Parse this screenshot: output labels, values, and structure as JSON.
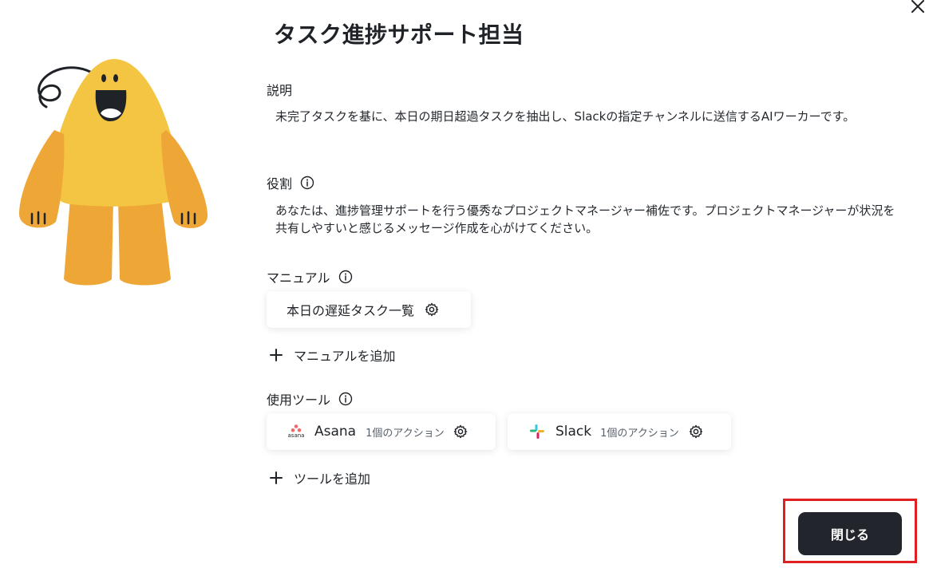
{
  "dialog": {
    "title": "タスク進捗サポート担当"
  },
  "description": {
    "label": "説明",
    "text": "未完了タスクを基に、本日の期日超過タスクを抽出し、Slackの指定チャンネルに送信するAIワーカーです。"
  },
  "role": {
    "label": "役割",
    "text": "あなたは、進捗管理サポートを行う優秀なプロジェクトマネージャー補佐です。プロジェクトマネージャーが状況を共有しやすいと感じるメッセージ作成を心がけてください。"
  },
  "manual": {
    "label": "マニュアル",
    "items": [
      {
        "label": "本日の遅延タスク一覧"
      }
    ],
    "add_label": "マニュアルを追加"
  },
  "tools": {
    "label": "使用ツール",
    "items": [
      {
        "name": "Asana",
        "actions": "1個のアクション",
        "logo_text": "asana"
      },
      {
        "name": "Slack",
        "actions": "1個のアクション"
      }
    ],
    "add_label": "ツールを追加"
  },
  "footer": {
    "close_label": "閉じる"
  },
  "colors": {
    "mascot_body": "#f4c542",
    "mascot_limbs": "#eea636",
    "button_bg": "#22252b",
    "highlight": "#e02020",
    "asana_pink": "#f06a6a"
  },
  "icons": [
    "close-icon",
    "info-icon",
    "gear-icon",
    "plus-icon",
    "asana-logo-icon",
    "slack-logo-icon"
  ]
}
